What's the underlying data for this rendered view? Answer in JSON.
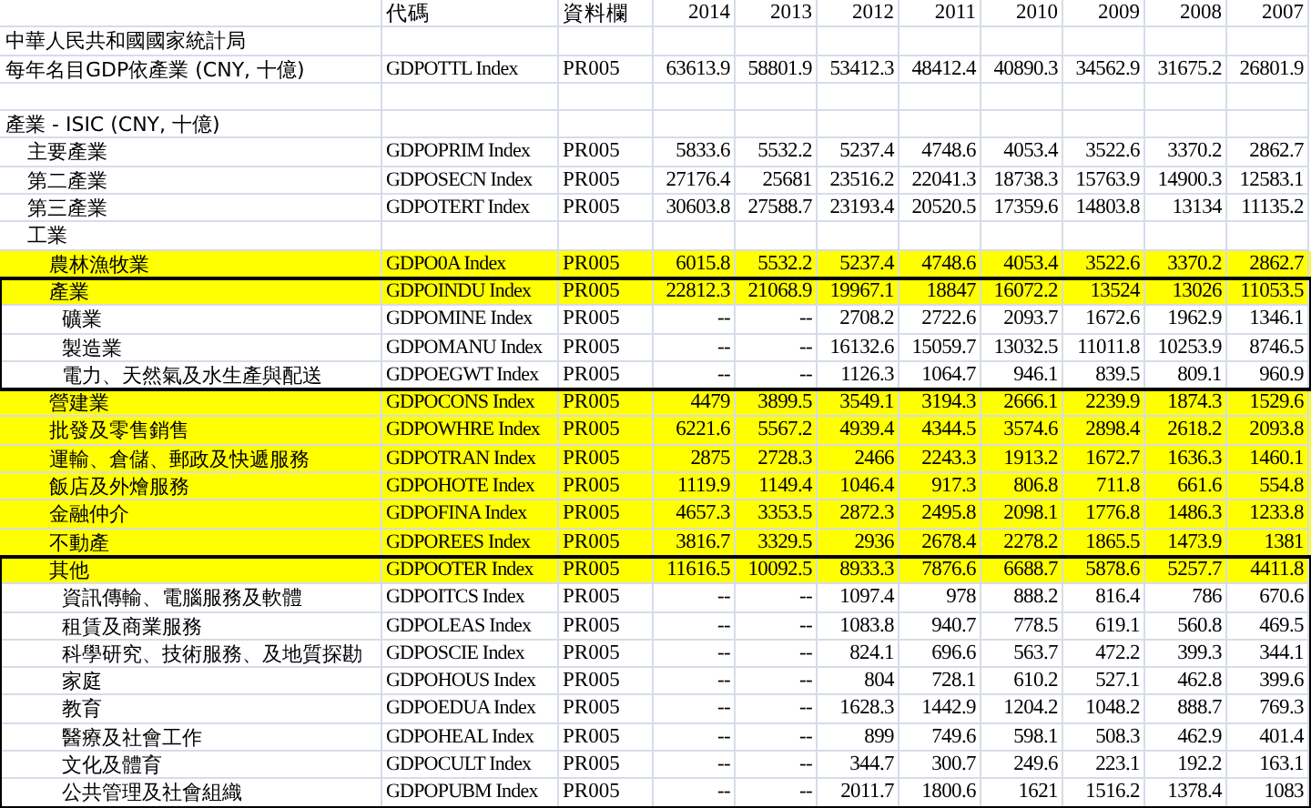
{
  "header": {
    "code": "代碼",
    "source": "資料欄",
    "years": [
      "2014",
      "2013",
      "2012",
      "2011",
      "2010",
      "2009",
      "2008",
      "2007"
    ]
  },
  "sections": [
    {
      "rows": [
        {
          "label": "中華人民共和國國家統計局",
          "highlighted": false,
          "outlined": false
        },
        {
          "label": "每年名目GDP依產業 (CNY, 十億)",
          "code": "GDPOTTL Index",
          "source": "PR005",
          "values": [
            "63613.9",
            "58801.9",
            "53412.3",
            "48412.4",
            "40890.3",
            "34562.9",
            "31675.2",
            "26801.9"
          ],
          "highlighted": false,
          "outlined": false
        }
      ]
    },
    {
      "rows": [
        {
          "label": "產業 - ISIC (CNY, 十億)",
          "highlighted": false,
          "outlined": false,
          "children": [
            {
              "label": "主要產業",
              "code": "GDPOPRIM Index",
              "source": "PR005",
              "values": [
                "5833.6",
                "5532.2",
                "5237.4",
                "4748.6",
                "4053.4",
                "3522.6",
                "3370.2",
                "2862.7"
              ],
              "highlighted": false,
              "outlined": false
            },
            {
              "label": "第二產業",
              "code": "GDPOSECN Index",
              "source": "PR005",
              "values": [
                "27176.4",
                "25681",
                "23516.2",
                "22041.3",
                "18738.3",
                "15763.9",
                "14900.3",
                "12583.1"
              ],
              "highlighted": false,
              "outlined": false
            },
            {
              "label": "第三產業",
              "code": "GDPOTERT Index",
              "source": "PR005",
              "values": [
                "30603.8",
                "27588.7",
                "23193.4",
                "20520.5",
                "17359.6",
                "14803.8",
                "13134",
                "11135.2"
              ],
              "highlighted": false,
              "outlined": false
            },
            {
              "label": "工業",
              "highlighted": false,
              "outlined": false,
              "children": [
                {
                  "label": "農林漁牧業",
                  "code": "GDPO0A Index",
                  "source": "PR005",
                  "values": [
                    "6015.8",
                    "5532.2",
                    "5237.4",
                    "4748.6",
                    "4053.4",
                    "3522.6",
                    "3370.2",
                    "2862.7"
                  ],
                  "highlighted": true,
                  "outlined": false
                },
                {
                  "label": "產業",
                  "code": "GDPOINDU Index",
                  "source": "PR005",
                  "values": [
                    "22812.3",
                    "21068.9",
                    "19967.1",
                    "18847",
                    "16072.2",
                    "13524",
                    "13026",
                    "11053.5"
                  ],
                  "highlighted": true,
                  "outlined": true,
                  "children": [
                    {
                      "label": "礦業",
                      "code": "GDPOMINE Index",
                      "source": "PR005",
                      "values": [
                        "--",
                        "--",
                        "2708.2",
                        "2722.6",
                        "2093.7",
                        "1672.6",
                        "1962.9",
                        "1346.1"
                      ],
                      "highlighted": false,
                      "outlined": false
                    },
                    {
                      "label": "製造業",
                      "code": "GDPOMANU Index",
                      "source": "PR005",
                      "values": [
                        "--",
                        "--",
                        "16132.6",
                        "15059.7",
                        "13032.5",
                        "11011.8",
                        "10253.9",
                        "8746.5"
                      ],
                      "highlighted": false,
                      "outlined": false
                    },
                    {
                      "label": "電力、天然氣及水生產與配送",
                      "code": "GDPOEGWT Index",
                      "source": "PR005",
                      "values": [
                        "--",
                        "--",
                        "1126.3",
                        "1064.7",
                        "946.1",
                        "839.5",
                        "809.1",
                        "960.9"
                      ],
                      "highlighted": false,
                      "outlined": false
                    }
                  ]
                },
                {
                  "label": "營建業",
                  "code": "GDPOCONS Index",
                  "source": "PR005",
                  "values": [
                    "4479",
                    "3899.5",
                    "3549.1",
                    "3194.3",
                    "2666.1",
                    "2239.9",
                    "1874.3",
                    "1529.6"
                  ],
                  "highlighted": true,
                  "outlined": false
                },
                {
                  "label": "批發及零售銷售",
                  "code": "GDPOWHRE Index",
                  "source": "PR005",
                  "values": [
                    "6221.6",
                    "5567.2",
                    "4939.4",
                    "4344.5",
                    "3574.6",
                    "2898.4",
                    "2618.2",
                    "2093.8"
                  ],
                  "highlighted": true,
                  "outlined": false
                },
                {
                  "label": "運輸、倉儲、郵政及快遞服務",
                  "code": "GDPOTRAN Index",
                  "source": "PR005",
                  "values": [
                    "2875",
                    "2728.3",
                    "2466",
                    "2243.3",
                    "1913.2",
                    "1672.7",
                    "1636.3",
                    "1460.1"
                  ],
                  "highlighted": true,
                  "outlined": false
                },
                {
                  "label": "飯店及外燴服務",
                  "code": "GDPOHOTE Index",
                  "source": "PR005",
                  "values": [
                    "1119.9",
                    "1149.4",
                    "1046.4",
                    "917.3",
                    "806.8",
                    "711.8",
                    "661.6",
                    "554.8"
                  ],
                  "highlighted": true,
                  "outlined": false
                },
                {
                  "label": "金融仲介",
                  "code": "GDPOFINA Index",
                  "source": "PR005",
                  "values": [
                    "4657.3",
                    "3353.5",
                    "2872.3",
                    "2495.8",
                    "2098.1",
                    "1776.8",
                    "1486.3",
                    "1233.8"
                  ],
                  "highlighted": true,
                  "outlined": false
                },
                {
                  "label": "不動產",
                  "code": "GDPOREES Index",
                  "source": "PR005",
                  "values": [
                    "3816.7",
                    "3329.5",
                    "2936",
                    "2678.4",
                    "2278.2",
                    "1865.5",
                    "1473.9",
                    "1381"
                  ],
                  "highlighted": true,
                  "outlined": false
                },
                {
                  "label": "其他",
                  "code": "GDPOOTER Index",
                  "source": "PR005",
                  "values": [
                    "11616.5",
                    "10092.5",
                    "8933.3",
                    "7876.6",
                    "6688.7",
                    "5878.6",
                    "5257.7",
                    "4411.8"
                  ],
                  "highlighted": true,
                  "outlined": true,
                  "children": [
                    {
                      "label": "資訊傳輸、電腦服務及軟體",
                      "code": "GDPOITCS Index",
                      "source": "PR005",
                      "values": [
                        "--",
                        "--",
                        "1097.4",
                        "978",
                        "888.2",
                        "816.4",
                        "786",
                        "670.6"
                      ],
                      "highlighted": false,
                      "outlined": false
                    },
                    {
                      "label": "租賃及商業服務",
                      "code": "GDPOLEAS Index",
                      "source": "PR005",
                      "values": [
                        "--",
                        "--",
                        "1083.8",
                        "940.7",
                        "778.5",
                        "619.1",
                        "560.8",
                        "469.5"
                      ],
                      "highlighted": false,
                      "outlined": false
                    },
                    {
                      "label": "科學研究、技術服務、及地質探勘",
                      "code": "GDPOSCIE Index",
                      "source": "PR005",
                      "values": [
                        "--",
                        "--",
                        "824.1",
                        "696.6",
                        "563.7",
                        "472.2",
                        "399.3",
                        "344.1"
                      ],
                      "highlighted": false,
                      "outlined": false
                    },
                    {
                      "label": "家庭",
                      "code": "GDPOHOUS Index",
                      "source": "PR005",
                      "values": [
                        "--",
                        "--",
                        "804",
                        "728.1",
                        "610.2",
                        "527.1",
                        "462.8",
                        "399.6"
                      ],
                      "highlighted": false,
                      "outlined": false
                    },
                    {
                      "label": "教育",
                      "code": "GDPOEDUA Index",
                      "source": "PR005",
                      "values": [
                        "--",
                        "--",
                        "1628.3",
                        "1442.9",
                        "1204.2",
                        "1048.2",
                        "888.7",
                        "769.3"
                      ],
                      "highlighted": false,
                      "outlined": false
                    },
                    {
                      "label": "醫療及社會工作",
                      "code": "GDPOHEAL Index",
                      "source": "PR005",
                      "values": [
                        "--",
                        "--",
                        "899",
                        "749.6",
                        "598.1",
                        "508.3",
                        "462.9",
                        "401.4"
                      ],
                      "highlighted": false,
                      "outlined": false
                    },
                    {
                      "label": "文化及體育",
                      "code": "GDPOCULT Index",
                      "source": "PR005",
                      "values": [
                        "--",
                        "--",
                        "344.7",
                        "300.7",
                        "249.6",
                        "223.1",
                        "192.2",
                        "163.1"
                      ],
                      "highlighted": false,
                      "outlined": false
                    },
                    {
                      "label": "公共管理及社會組織",
                      "code": "GDPOPUBM Index",
                      "source": "PR005",
                      "values": [
                        "--",
                        "--",
                        "2011.7",
                        "1800.6",
                        "1621",
                        "1516.2",
                        "1378.4",
                        "1083"
                      ],
                      "highlighted": false,
                      "outlined": false
                    }
                  ]
                }
              ]
            }
          ]
        }
      ]
    }
  ]
}
